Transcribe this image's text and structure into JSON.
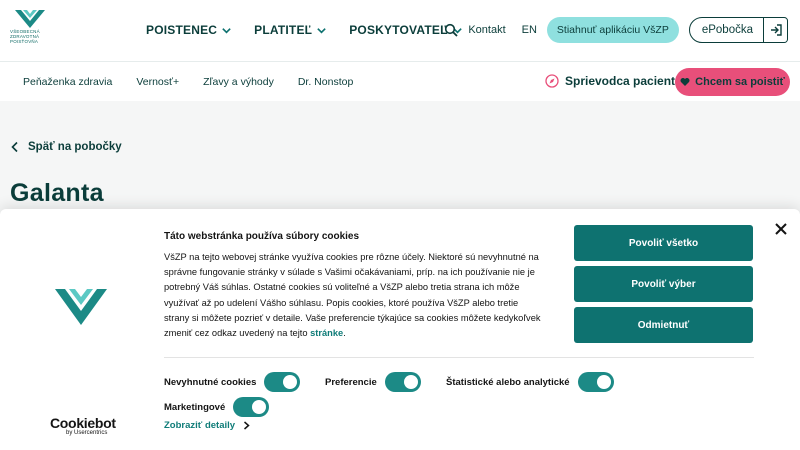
{
  "logo": {
    "text_lines": [
      "VŠEOBECNÁ",
      "ZDRAVOTNÁ",
      "POISŤOVŇA"
    ]
  },
  "main_nav": [
    {
      "label": "POISTENEC"
    },
    {
      "label": "PLATITEĽ"
    },
    {
      "label": "POSKYTOVATEĽ"
    }
  ],
  "tools": {
    "search_icon": "search-icon",
    "contact": "Kontakt",
    "language": "EN",
    "app_button": "Stiahnuť aplikáciu VšZP",
    "epobocka": "ePobočka"
  },
  "sub_nav": [
    {
      "label": "Peňaženka zdravia"
    },
    {
      "label": "Vernosť+"
    },
    {
      "label": "Zľavy a výhody"
    },
    {
      "label": "Dr. Nonstop"
    }
  ],
  "guide": {
    "label": "Sprievodca pacienta",
    "icon": "compass-icon"
  },
  "join_button": {
    "label": "Chcem sa poistiť",
    "icon": "heart-icon"
  },
  "page": {
    "back_label": "Späť na pobočky",
    "title": "Galanta"
  },
  "cookie": {
    "title": "Táto webstránka používa súbory cookies",
    "body": "VšZP na tejto webovej stránke využíva cookies pre rôzne účely. Niektoré sú nevyhnutné na správne fungovanie stránky v súlade s Vašimi očakávaniami, príp. na ich používanie nie je potrebný Váš súhlas. Ostatné cookies sú voliteľné a VšZP alebo tretia strana ich môže využívať až po udelení Vášho súhlasu. Popis cookies, ktoré používa VšZP alebo tretie strany si môžete pozrieť v detaile. Vaše preferencie týkajúce sa cookies môžete kedykoľvek zmeniť cez odkaz uvedený na tejto ",
    "body_link": "stránke",
    "body_end": ".",
    "buttons": {
      "allow_all": "Povoliť všetko",
      "allow_selection": "Povoliť výber",
      "reject": "Odmietnuť"
    },
    "toggles": [
      {
        "label": "Nevyhnutné cookies",
        "on": true
      },
      {
        "label": "Preferencie",
        "on": true
      },
      {
        "label": "Štatistické alebo analytické",
        "on": true
      },
      {
        "label": "Marketingové",
        "on": true
      }
    ],
    "details_label": "Zobraziť detaily",
    "provider": {
      "brand": "Cookiebot",
      "sub": "by Usercentrics"
    }
  },
  "colors": {
    "primary": "#0e7270",
    "accent": "#8fe0df",
    "pink": "#e84f7a",
    "dark": "#0b3d3a"
  }
}
